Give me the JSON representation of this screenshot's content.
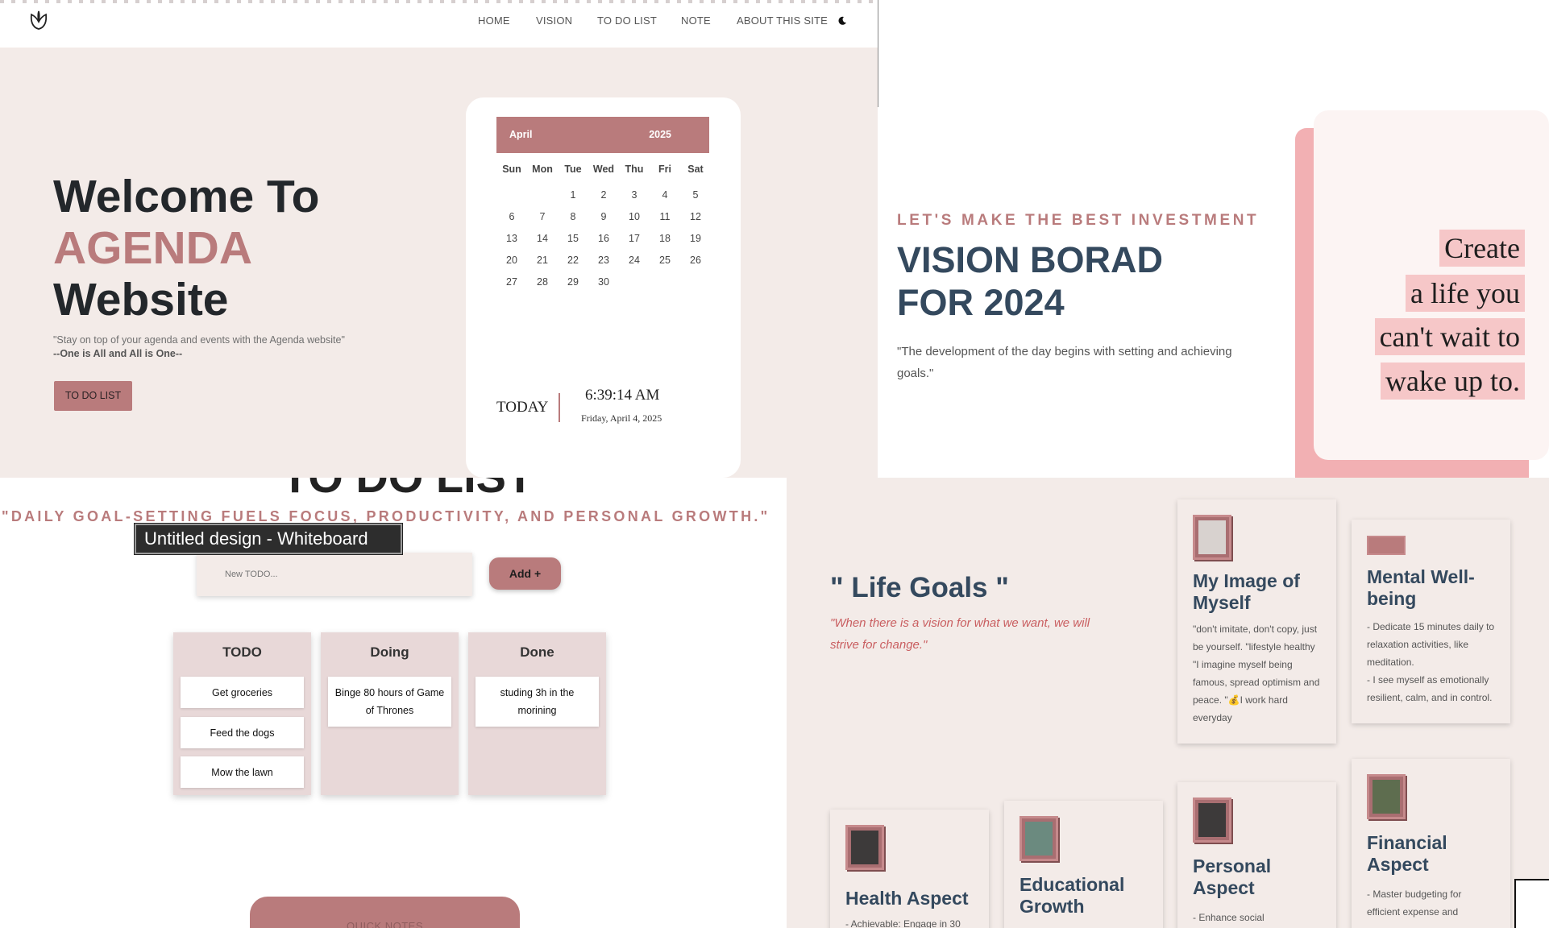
{
  "nav": {
    "logo_icon": "leaf-logo-icon",
    "items": [
      "HOME",
      "VISION",
      "TO DO LIST",
      "NOTE",
      "ABOUT THIS SITE"
    ],
    "theme_icon": "moon-icon"
  },
  "hero": {
    "title_line1": "Welcome To",
    "title_line2": "AGENDA",
    "title_line3": "Website",
    "quote_line1": "\"Stay on top of your agenda and events with the Agenda website\"",
    "quote_line2": "--One is All and All is One--",
    "button": "TO DO LIST"
  },
  "calendar": {
    "month": "April",
    "year": "2025",
    "weekdays": [
      "Sun",
      "Mon",
      "Tue",
      "Wed",
      "Thu",
      "Fri",
      "Sat"
    ],
    "first_weekday": 2,
    "days_in_month": 30,
    "today_label": "TODAY",
    "time": "6:39:14 AM",
    "date": "Friday, April 4, 2025"
  },
  "vision": {
    "tagline": "LET'S MAKE THE BEST INVESTMENT",
    "title_line1": "VISION BORAD",
    "title_line2": "FOR 2024",
    "quote": "\"The development of the day begins with setting and achieving goals.\"",
    "poster_lines": [
      "Create",
      "a life you",
      "can't wait to",
      "wake up to."
    ]
  },
  "todo": {
    "big_title": "TO DO LIST",
    "subtitle": "\"DAILY GOAL-SETTING FUELS FOCUS, PRODUCTIVITY, AND PERSONAL GROWTH.\"",
    "input_placeholder": "New TODO...",
    "add_button": "Add +",
    "columns": [
      {
        "title": "TODO",
        "cards": [
          "Get groceries",
          "Feed the dogs",
          "Mow the lawn"
        ]
      },
      {
        "title": "Doing",
        "cards": [
          "Binge 80 hours of Game of Thrones"
        ]
      },
      {
        "title": "Done",
        "cards": [
          "studing 3h in the morining"
        ]
      }
    ],
    "quick_notes": "QUICK NOTES"
  },
  "tooltip": "Untitled design - Whiteboard",
  "goals": {
    "title": "\" Life Goals \"",
    "quote": "\"When there is a vision for what we want, we will strive for change.\"",
    "cards": [
      {
        "title": "My Image of Myself",
        "text": "\"don't imitate, don't copy, just be yourself. \"lifestyle healthy \"I imagine myself being famous, spread optimism and peace. \"💰I work hard everyday"
      },
      {
        "title": "Mental Well-being",
        "text": "- Dedicate 15 minutes daily to relaxation activities, like meditation.\n- I see myself as emotionally resilient, calm, and in control."
      },
      {
        "title": "Health Aspect",
        "text": "- Achievable: Engage in 30"
      },
      {
        "title": "Educational Growth",
        "text": ""
      },
      {
        "title": "Personal Aspect",
        "text": "- Enhance social"
      },
      {
        "title": "Financial Aspect",
        "text": "- Master budgeting for efficient expense and"
      }
    ]
  },
  "colors": {
    "accent": "#b97b7c",
    "background": "#f3ebe8",
    "heading": "#34495e",
    "poster_pink": "#f2b0b3"
  }
}
